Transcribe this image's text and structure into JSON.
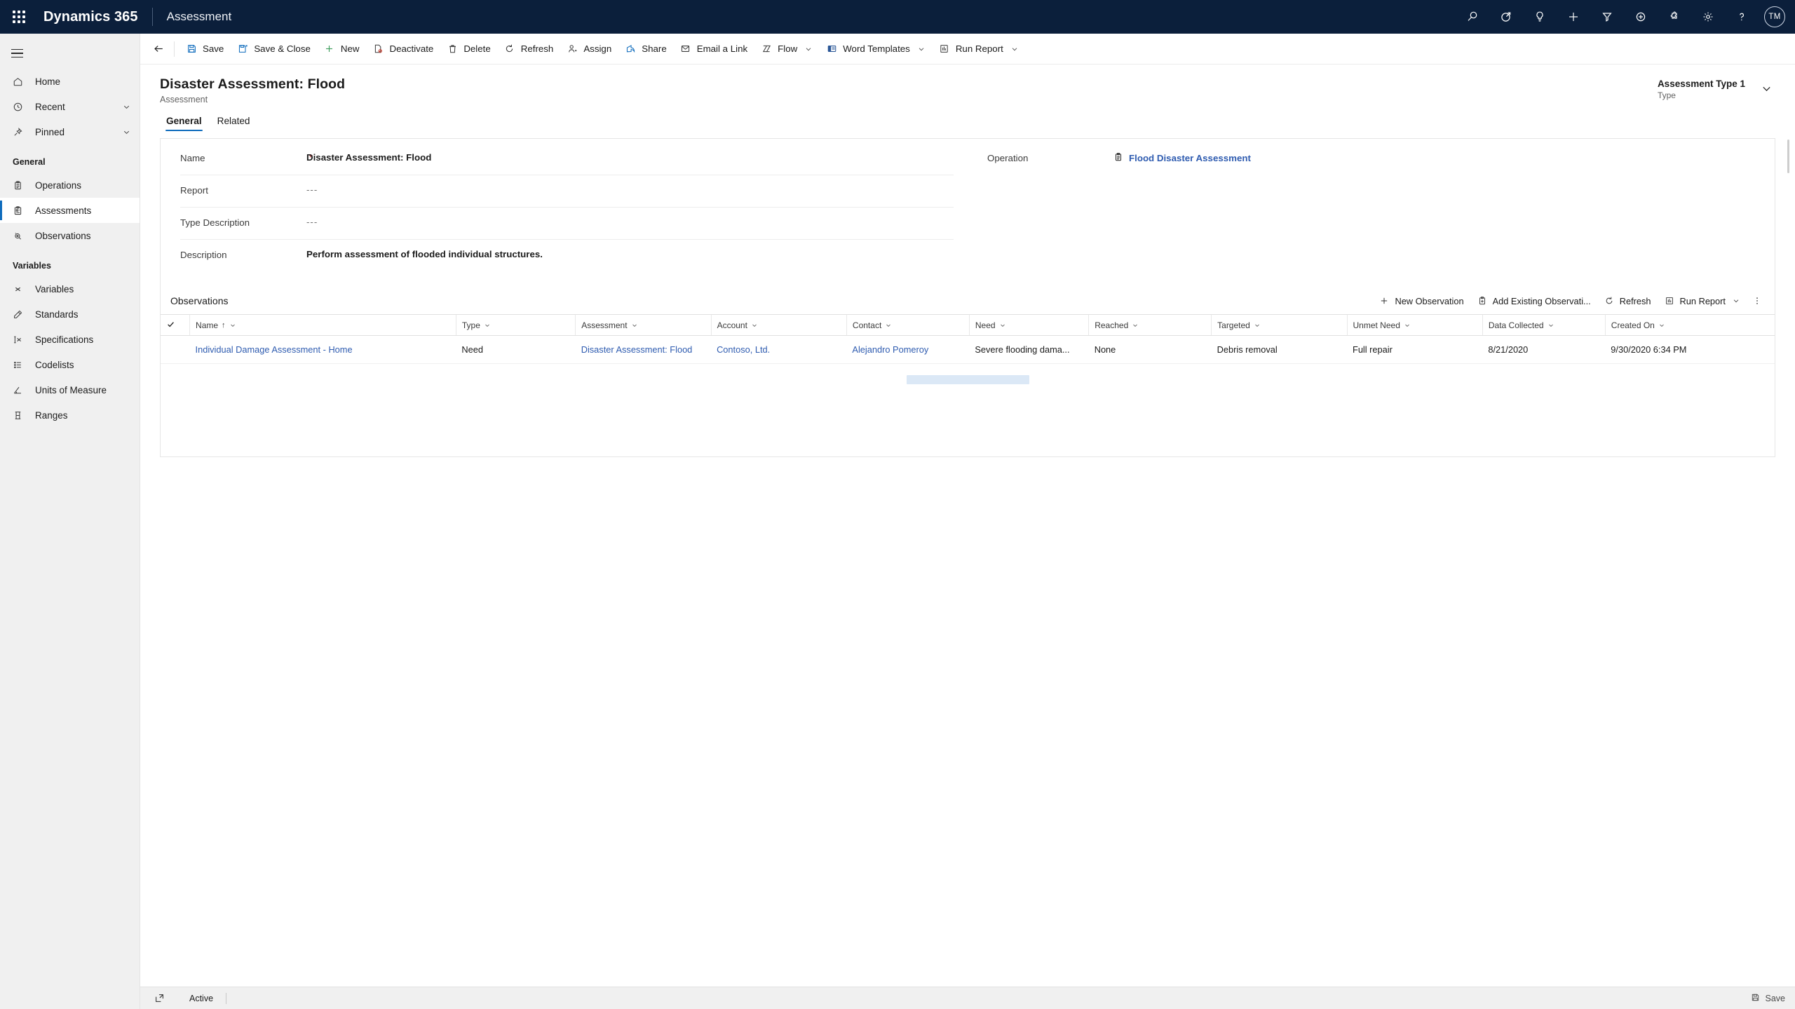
{
  "appbar": {
    "waffle_name": "app-launcher",
    "brand": "Dynamics 365",
    "app_name": "Assessment",
    "icons": [
      {
        "name": "search-icon",
        "label": "Search"
      },
      {
        "name": "diagnostics-icon",
        "label": "Diagnostics"
      },
      {
        "name": "lightbulb-icon",
        "label": "Insights"
      },
      {
        "name": "quick-create-icon",
        "label": "Quick Create"
      },
      {
        "name": "filter-icon",
        "label": "Filter"
      },
      {
        "name": "add-circle-icon",
        "label": "Add"
      },
      {
        "name": "puzzle-icon",
        "label": "Extensions"
      },
      {
        "name": "gear-icon",
        "label": "Settings"
      },
      {
        "name": "help-icon",
        "label": "Help"
      }
    ],
    "avatar_initials": "TM"
  },
  "sidebar": {
    "hamburger_name": "site-map-toggle",
    "top_items": [
      {
        "label": "Home",
        "icon": "home-icon",
        "chevron": false,
        "selected": false
      },
      {
        "label": "Recent",
        "icon": "clock-icon",
        "chevron": true,
        "selected": false
      },
      {
        "label": "Pinned",
        "icon": "pin-icon",
        "chevron": true,
        "selected": false
      }
    ],
    "groups": [
      {
        "title": "General",
        "items": [
          {
            "label": "Operations",
            "icon": "clipboard-icon",
            "selected": false
          },
          {
            "label": "Assessments",
            "icon": "assessment-icon",
            "selected": true
          },
          {
            "label": "Observations",
            "icon": "observation-icon",
            "selected": false
          }
        ]
      },
      {
        "title": "Variables",
        "items": [
          {
            "label": "Variables",
            "icon": "variable-x-icon",
            "selected": false
          },
          {
            "label": "Standards",
            "icon": "ruler-icon",
            "selected": false
          },
          {
            "label": "Specifications",
            "icon": "spec-icon",
            "selected": false
          },
          {
            "label": "Codelists",
            "icon": "list-icon",
            "selected": false
          },
          {
            "label": "Units of Measure",
            "icon": "angle-icon",
            "selected": false
          },
          {
            "label": "Ranges",
            "icon": "range-icon",
            "selected": false
          }
        ]
      }
    ]
  },
  "commandbar": {
    "back_name": "back-button",
    "buttons": [
      {
        "label": "Save",
        "icon": "save-icon",
        "caret": false
      },
      {
        "label": "Save & Close",
        "icon": "save-close-icon",
        "caret": false
      },
      {
        "label": "New",
        "icon": "plus-icon",
        "caret": false
      },
      {
        "label": "Deactivate",
        "icon": "deactivate-icon",
        "caret": false
      },
      {
        "label": "Delete",
        "icon": "trash-icon",
        "caret": false
      },
      {
        "label": "Refresh",
        "icon": "refresh-icon",
        "caret": false
      },
      {
        "label": "Assign",
        "icon": "assign-icon",
        "caret": false
      },
      {
        "label": "Share",
        "icon": "share-icon",
        "caret": false
      },
      {
        "label": "Email a Link",
        "icon": "email-link-icon",
        "caret": false
      },
      {
        "label": "Flow",
        "icon": "flow-icon",
        "caret": true
      },
      {
        "label": "Word Templates",
        "icon": "word-icon",
        "caret": true
      },
      {
        "label": "Run Report",
        "icon": "report-icon",
        "caret": true
      }
    ]
  },
  "record_header": {
    "title": "Disaster Assessment: Flood",
    "subtitle": "Assessment",
    "header_field_value": "Assessment Type 1",
    "header_field_label": "Type",
    "chevron_name": "header-expand-chevron"
  },
  "tabs": [
    {
      "label": "General",
      "active": true
    },
    {
      "label": "Related",
      "active": false
    }
  ],
  "form": {
    "left_fields": [
      {
        "label": "Name",
        "value": "Disaster Assessment: Flood",
        "required": true,
        "muted": false,
        "link": false
      },
      {
        "label": "Report",
        "value": "---",
        "required": false,
        "muted": true,
        "link": false
      },
      {
        "label": "Type Description",
        "value": "---",
        "required": false,
        "muted": true,
        "link": false
      },
      {
        "label": "Description",
        "value": "Perform assessment of flooded individual structures.",
        "required": false,
        "muted": false,
        "link": false
      }
    ],
    "right_fields": [
      {
        "label": "Operation",
        "value": "Flood Disaster Assessment",
        "required": false,
        "muted": false,
        "link": true,
        "icon": "clipboard-icon"
      }
    ]
  },
  "subgrid": {
    "title": "Observations",
    "commands": [
      {
        "label": "New Observation",
        "icon": "plus-icon",
        "caret": false
      },
      {
        "label": "Add Existing Observati...",
        "icon": "add-existing-icon",
        "caret": false
      },
      {
        "label": "Refresh",
        "icon": "refresh-icon",
        "caret": false
      },
      {
        "label": "Run Report",
        "icon": "report-icon",
        "caret": true
      }
    ],
    "more_name": "subgrid-overflow-button",
    "columns": [
      {
        "label": "Name",
        "sorted": true,
        "sort_dir": "asc",
        "width": "17%"
      },
      {
        "label": "Type",
        "sorted": false,
        "width": "7.2%"
      },
      {
        "label": "Assessment",
        "sorted": false,
        "width": "8.2%"
      },
      {
        "label": "Account",
        "sorted": false,
        "width": "8.2%"
      },
      {
        "label": "Contact",
        "sorted": false,
        "width": "7.6%"
      },
      {
        "label": "Need",
        "sorted": false,
        "width": "7.2%"
      },
      {
        "label": "Reached",
        "sorted": false,
        "width": "7.6%"
      },
      {
        "label": "Targeted",
        "sorted": false,
        "width": "8.2%"
      },
      {
        "label": "Unmet Need",
        "sorted": false,
        "width": "8.2%"
      },
      {
        "label": "Data Collected",
        "sorted": false,
        "width": "7.6%"
      },
      {
        "label": "Created On",
        "sorted": false,
        "width": "10.8%"
      }
    ],
    "rows": [
      {
        "name": "Individual Damage Assessment - Home",
        "type": "Need",
        "assessment": "Disaster Assessment: Flood",
        "account": "Contoso, Ltd.",
        "contact": "Alejandro Pomeroy",
        "need": "Severe flooding dama...",
        "reached": "None",
        "targeted": "Debris removal",
        "unmet_need": "Full repair",
        "data_collected": "8/21/2020",
        "created_on": "9/30/2020 6:34 PM"
      }
    ]
  },
  "footer": {
    "popout_icon": "popout-icon",
    "status": "Active",
    "save_label": "Save",
    "save_icon": "save-icon"
  },
  "colors": {
    "appbar_bg": "#0b1f3b",
    "accent": "#0f6cbd",
    "link": "#2f5cb0",
    "required": "#a80000",
    "sidebar_bg": "#f0f0f0"
  }
}
